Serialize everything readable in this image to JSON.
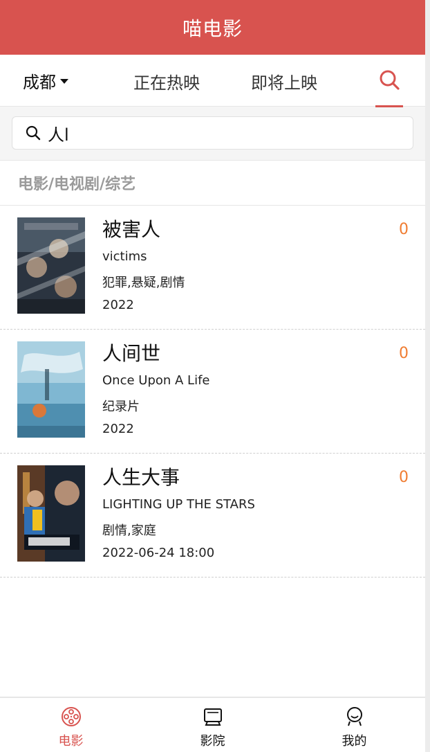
{
  "header": {
    "title": "喵电影"
  },
  "nav": {
    "city": "成都",
    "tab_now": "正在热映",
    "tab_soon": "即将上映",
    "search_icon": "search-icon",
    "active": "search"
  },
  "search": {
    "value": "人l",
    "icon": "search-icon"
  },
  "section": {
    "title": "电影/电视剧/综艺"
  },
  "movies": [
    {
      "name": "被害人",
      "en_name": "victims",
      "genres": "犯罪,悬疑,剧情",
      "date": "2022",
      "score": "0"
    },
    {
      "name": "人间世",
      "en_name": "Once Upon A Life",
      "genres": "纪录片",
      "date": "2022",
      "score": "0"
    },
    {
      "name": "人生大事",
      "en_name": "LIGHTING UP THE STARS",
      "genres": "剧情,家庭",
      "date": "2022-06-24 18:00",
      "score": "0"
    }
  ],
  "tabbar": {
    "items": [
      {
        "label": "电影",
        "icon": "film-reel-icon",
        "active": true
      },
      {
        "label": "影院",
        "icon": "cinema-screen-icon",
        "active": false
      },
      {
        "label": "我的",
        "icon": "user-icon",
        "active": false
      }
    ]
  },
  "colors": {
    "brand": "#d8534f",
    "score": "#f07c31",
    "section_text": "#9a9a9a"
  }
}
